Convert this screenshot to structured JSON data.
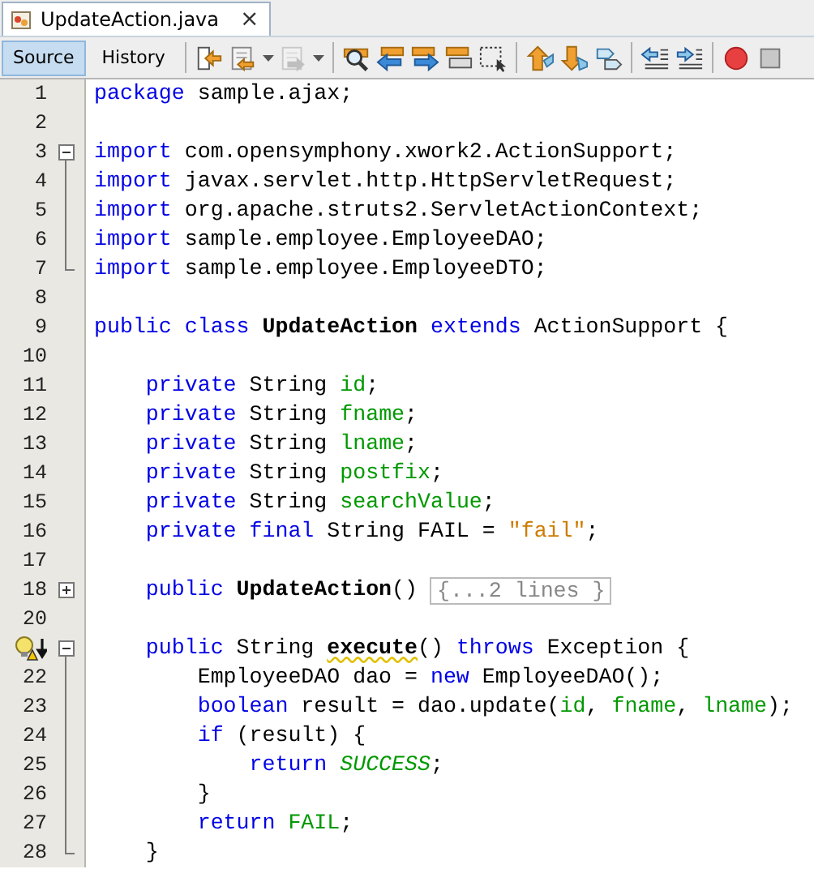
{
  "file_tab": {
    "title": "UpdateAction.java",
    "close": "×"
  },
  "view_tabs": [
    {
      "label": "Source",
      "selected": true
    },
    {
      "label": "History",
      "selected": false
    }
  ],
  "toolbar": [
    {
      "kind": "jump-back",
      "disabled": false
    },
    {
      "kind": "prev-edit",
      "disabled": false
    },
    {
      "kind": "next-edit",
      "disabled": true
    },
    {
      "kind": "separator"
    },
    {
      "kind": "find",
      "disabled": false
    },
    {
      "kind": "find-prev",
      "disabled": false
    },
    {
      "kind": "find-next",
      "disabled": false
    },
    {
      "kind": "highlight",
      "disabled": false
    },
    {
      "kind": "select",
      "disabled": false
    },
    {
      "kind": "separator"
    },
    {
      "kind": "up",
      "disabled": false
    },
    {
      "kind": "down",
      "disabled": false
    },
    {
      "kind": "tags",
      "disabled": false
    },
    {
      "kind": "separator"
    },
    {
      "kind": "outdent",
      "disabled": false
    },
    {
      "kind": "indent",
      "disabled": false
    },
    {
      "kind": "separator"
    },
    {
      "kind": "record",
      "disabled": false
    },
    {
      "kind": "stop",
      "disabled": false
    }
  ],
  "lines": [
    {
      "number": "1",
      "tokens": [
        {
          "kind": "kw",
          "text": "package"
        },
        {
          "kind": "plain",
          "text": " sample.ajax;"
        }
      ]
    },
    {
      "number": "2"
    },
    {
      "number": "3",
      "expanded": true,
      "tokens": [
        {
          "kind": "kw",
          "text": "import"
        },
        {
          "kind": "plain",
          "text": " com.opensymphony.xwork2.ActionSupport;"
        }
      ]
    },
    {
      "number": "4",
      "tokens": [
        {
          "kind": "kw",
          "text": "import"
        },
        {
          "kind": "plain",
          "text": " javax.servlet.http.HttpServletRequest;"
        }
      ]
    },
    {
      "number": "5",
      "tokens": [
        {
          "kind": "kw",
          "text": "import"
        },
        {
          "kind": "plain",
          "text": " org.apache.struts2.ServletActionContext;"
        }
      ]
    },
    {
      "number": "6",
      "tokens": [
        {
          "kind": "kw",
          "text": "import"
        },
        {
          "kind": "plain",
          "text": " sample.employee.EmployeeDAO;"
        }
      ]
    },
    {
      "number": "7",
      "fold_end": true,
      "tokens": [
        {
          "kind": "kw",
          "text": "import"
        },
        {
          "kind": "plain",
          "text": " sample.employee.EmployeeDTO;"
        }
      ]
    },
    {
      "number": "8"
    },
    {
      "number": "9",
      "tokens": [
        {
          "kind": "kw",
          "text": "public class"
        },
        {
          "kind": "decl",
          "text": " UpdateAction"
        },
        {
          "kind": "kw",
          "text": " extends"
        },
        {
          "kind": "plain",
          "text": " ActionSupport {"
        }
      ]
    },
    {
      "number": "10"
    },
    {
      "number": "11",
      "tokens": [
        {
          "kind": "kw",
          "text": "    private"
        },
        {
          "kind": "plain",
          "text": " String "
        },
        {
          "kind": "field",
          "text": "id"
        },
        {
          "kind": "plain",
          "text": ";"
        }
      ]
    },
    {
      "number": "12",
      "tokens": [
        {
          "kind": "kw",
          "text": "    private"
        },
        {
          "kind": "plain",
          "text": " String "
        },
        {
          "kind": "field",
          "text": "fname"
        },
        {
          "kind": "plain",
          "text": ";"
        }
      ]
    },
    {
      "number": "13",
      "tokens": [
        {
          "kind": "kw",
          "text": "    private"
        },
        {
          "kind": "plain",
          "text": " String "
        },
        {
          "kind": "field",
          "text": "lname"
        },
        {
          "kind": "plain",
          "text": ";"
        }
      ]
    },
    {
      "number": "14",
      "tokens": [
        {
          "kind": "kw",
          "text": "    private"
        },
        {
          "kind": "plain",
          "text": " String "
        },
        {
          "kind": "field",
          "text": "postfix"
        },
        {
          "kind": "plain",
          "text": ";"
        }
      ]
    },
    {
      "number": "15",
      "tokens": [
        {
          "kind": "kw",
          "text": "    private"
        },
        {
          "kind": "plain",
          "text": " String "
        },
        {
          "kind": "field",
          "text": "searchValue"
        },
        {
          "kind": "plain",
          "text": ";"
        }
      ]
    },
    {
      "number": "16",
      "tokens": [
        {
          "kind": "kw",
          "text": "    private final"
        },
        {
          "kind": "plain",
          "text": " String FAIL = "
        },
        {
          "kind": "str",
          "text": "\"fail\""
        },
        {
          "kind": "plain",
          "text": ";"
        }
      ]
    },
    {
      "number": "17"
    },
    {
      "number": "18",
      "expanded": false,
      "tokens": [
        {
          "kind": "kw",
          "text": "    public"
        },
        {
          "kind": "decl",
          "text": " UpdateAction"
        },
        {
          "kind": "plain",
          "text": "() "
        },
        {
          "kind": "foldbox",
          "text": "{...2 lines }"
        }
      ]
    },
    {
      "number": "20"
    },
    {
      "hint": true,
      "expanded": true,
      "tokens": [
        {
          "kind": "kw",
          "text": "    public"
        },
        {
          "kind": "plain",
          "text": " String "
        },
        {
          "kind": "warn",
          "text": "execute"
        },
        {
          "kind": "plain",
          "text": "() "
        },
        {
          "kind": "kw",
          "text": "throws"
        },
        {
          "kind": "plain",
          "text": " Exception {"
        }
      ]
    },
    {
      "number": "22",
      "tokens": [
        {
          "kind": "plain",
          "text": "        EmployeeDAO dao = "
        },
        {
          "kind": "kw",
          "text": "new"
        },
        {
          "kind": "plain",
          "text": " EmployeeDAO();"
        }
      ]
    },
    {
      "number": "23",
      "tokens": [
        {
          "kind": "kw",
          "text": "        boolean"
        },
        {
          "kind": "plain",
          "text": " result = dao.update("
        },
        {
          "kind": "field",
          "text": "id"
        },
        {
          "kind": "plain",
          "text": ", "
        },
        {
          "kind": "field",
          "text": "fname"
        },
        {
          "kind": "plain",
          "text": ", "
        },
        {
          "kind": "field",
          "text": "lname"
        },
        {
          "kind": "plain",
          "text": ");"
        }
      ]
    },
    {
      "number": "24",
      "tokens": [
        {
          "kind": "kw",
          "text": "        if"
        },
        {
          "kind": "plain",
          "text": " (result) {"
        }
      ]
    },
    {
      "number": "25",
      "tokens": [
        {
          "kind": "kw",
          "text": "            return"
        },
        {
          "kind": "const",
          "text": " SUCCESS"
        },
        {
          "kind": "plain",
          "text": ";"
        }
      ]
    },
    {
      "number": "26",
      "tokens": [
        {
          "kind": "plain",
          "text": "        }"
        }
      ]
    },
    {
      "number": "27",
      "tokens": [
        {
          "kind": "kw",
          "text": "        return"
        },
        {
          "kind": "cfield",
          "text": " FAIL"
        },
        {
          "kind": "plain",
          "text": ";"
        }
      ]
    },
    {
      "number": "28",
      "fold_end": true,
      "tokens": [
        {
          "kind": "plain",
          "text": "    }"
        }
      ]
    }
  ]
}
